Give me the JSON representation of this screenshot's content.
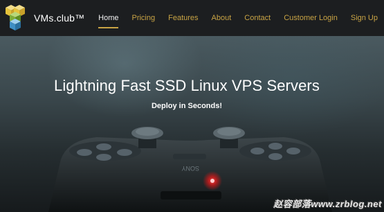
{
  "brand": {
    "name": "VMs.club™",
    "logo_icon": "cube-logo-icon"
  },
  "nav": {
    "items": [
      {
        "label": "Home",
        "active": true
      },
      {
        "label": "Pricing",
        "active": false
      },
      {
        "label": "Features",
        "active": false
      },
      {
        "label": "About",
        "active": false
      },
      {
        "label": "Contact",
        "active": false
      },
      {
        "label": "Customer Login",
        "active": false
      },
      {
        "label": "Sign Up",
        "active": false
      }
    ]
  },
  "hero": {
    "title": "Lightning Fast SSD Linux VPS Servers",
    "subtitle": "Deploy in Seconds!",
    "image_icon": "game-controller-icon",
    "controller_text": "SONY"
  },
  "watermark": "赵容部落www.zrblog.net",
  "colors": {
    "navbar_bg": "#1c1e20",
    "nav_link": "#c9a445",
    "nav_active": "#f1f1f1",
    "logo_yellow": "#e5c23a",
    "logo_green": "#7fae3a",
    "logo_blue": "#3f8fc4"
  }
}
